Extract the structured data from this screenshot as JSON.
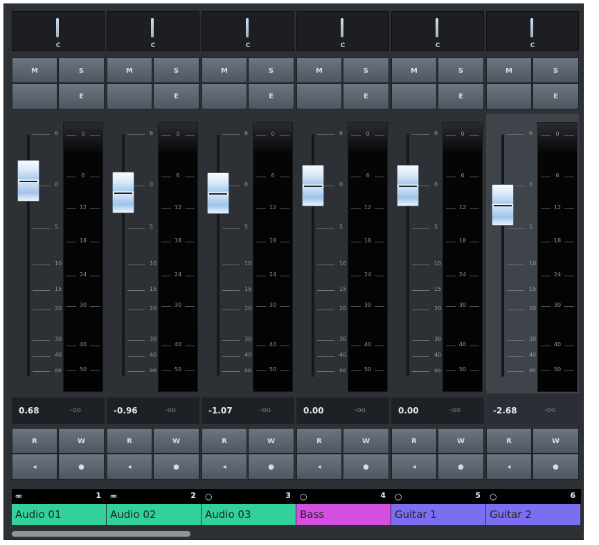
{
  "channels": [
    {
      "number": "1",
      "name": "Audio 01",
      "volume": "0.68",
      "peak": "-oo",
      "pan": "C",
      "color": "#33d19a",
      "icon": "stereo-rings-icon",
      "fader_db": 0.68,
      "mute_label": "M",
      "solo_label": "S",
      "edit_label": "E",
      "read_label": "R",
      "write_label": "W",
      "monitor_icon": "speaker-icon",
      "record_icon": "record-dot-icon",
      "icon_glyph": "⚮"
    },
    {
      "number": "2",
      "name": "Audio 02",
      "volume": "-0.96",
      "peak": "-oo",
      "pan": "C",
      "color": "#33d19a",
      "icon": "stereo-rings-icon",
      "fader_db": -0.96,
      "mute_label": "M",
      "solo_label": "S",
      "edit_label": "E",
      "read_label": "R",
      "write_label": "W",
      "monitor_icon": "speaker-icon",
      "record_icon": "record-dot-icon",
      "icon_glyph": "⚮"
    },
    {
      "number": "3",
      "name": "Audio 03",
      "volume": "-1.07",
      "peak": "-oo",
      "pan": "C",
      "color": "#33d19a",
      "icon": "mono-ring-icon",
      "fader_db": -1.07,
      "mute_label": "M",
      "solo_label": "S",
      "edit_label": "E",
      "read_label": "R",
      "write_label": "W",
      "monitor_icon": "speaker-icon",
      "record_icon": "record-dot-icon",
      "icon_glyph": "○"
    },
    {
      "number": "4",
      "name": "Bass",
      "volume": "0.00",
      "peak": "-oo",
      "pan": "C",
      "color": "#d34fe0",
      "icon": "mono-ring-icon",
      "fader_db": 0.0,
      "mute_label": "M",
      "solo_label": "S",
      "edit_label": "E",
      "read_label": "R",
      "write_label": "W",
      "monitor_icon": "speaker-icon",
      "record_icon": "record-dot-icon",
      "icon_glyph": "○"
    },
    {
      "number": "5",
      "name": "Guitar 1",
      "volume": "0.00",
      "peak": "-oo",
      "pan": "C",
      "color": "#7b6ef0",
      "icon": "mono-ring-icon",
      "fader_db": 0.0,
      "mute_label": "M",
      "solo_label": "S",
      "edit_label": "E",
      "read_label": "R",
      "write_label": "W",
      "monitor_icon": "speaker-icon",
      "record_icon": "record-dot-icon",
      "icon_glyph": "○"
    },
    {
      "number": "6",
      "name": "Guitar 2",
      "volume": "-2.68",
      "peak": "-oo",
      "pan": "C",
      "color": "#7b6ef0",
      "icon": "mono-ring-icon",
      "fader_db": -2.68,
      "mute_label": "M",
      "solo_label": "S",
      "edit_label": "E",
      "read_label": "R",
      "write_label": "W",
      "monitor_icon": "speaker-icon",
      "record_icon": "record-dot-icon",
      "icon_glyph": "○"
    }
  ],
  "fader_scale": [
    "6",
    "0",
    "5",
    "10",
    "15",
    "20",
    "30",
    "40",
    "oo"
  ],
  "meter_scale": [
    "0",
    "6",
    "12",
    "18",
    "24",
    "30",
    "40",
    "50"
  ],
  "selected_channel": "6"
}
